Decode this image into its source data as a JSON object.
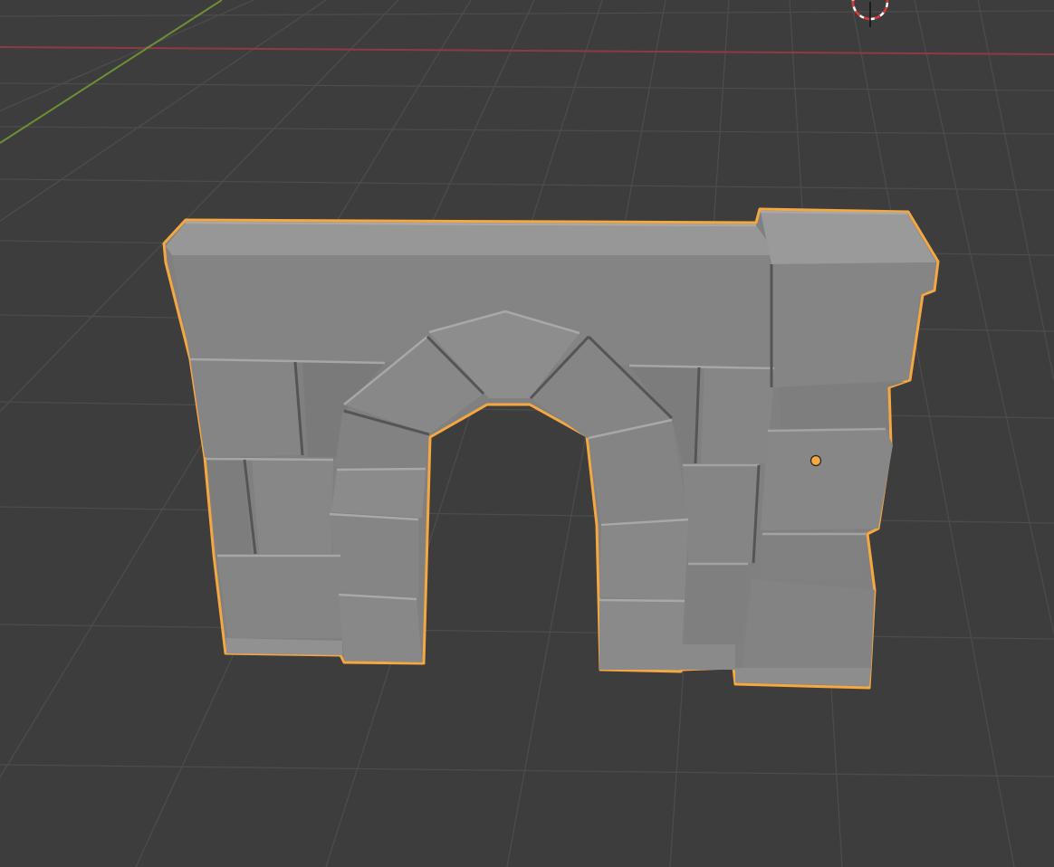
{
  "viewport": {
    "background_color": "#3d3d3d",
    "grid_color": "#4a4a4a",
    "x_axis_color": "#8e3a44",
    "y_axis_color": "#6d8f33",
    "selection_outline_color": "#f5a742",
    "origin_dot_color": "#f5a742",
    "mesh_face_light": "#8c8c8c",
    "mesh_face_mid": "#7f7f7f",
    "mesh_face_dark": "#6e6e6e",
    "mesh_top_color": "#999999",
    "selected_object": "stone-arch-wall",
    "icons": {
      "cursor": "3d-cursor-icon",
      "origin": "object-origin-icon"
    }
  }
}
